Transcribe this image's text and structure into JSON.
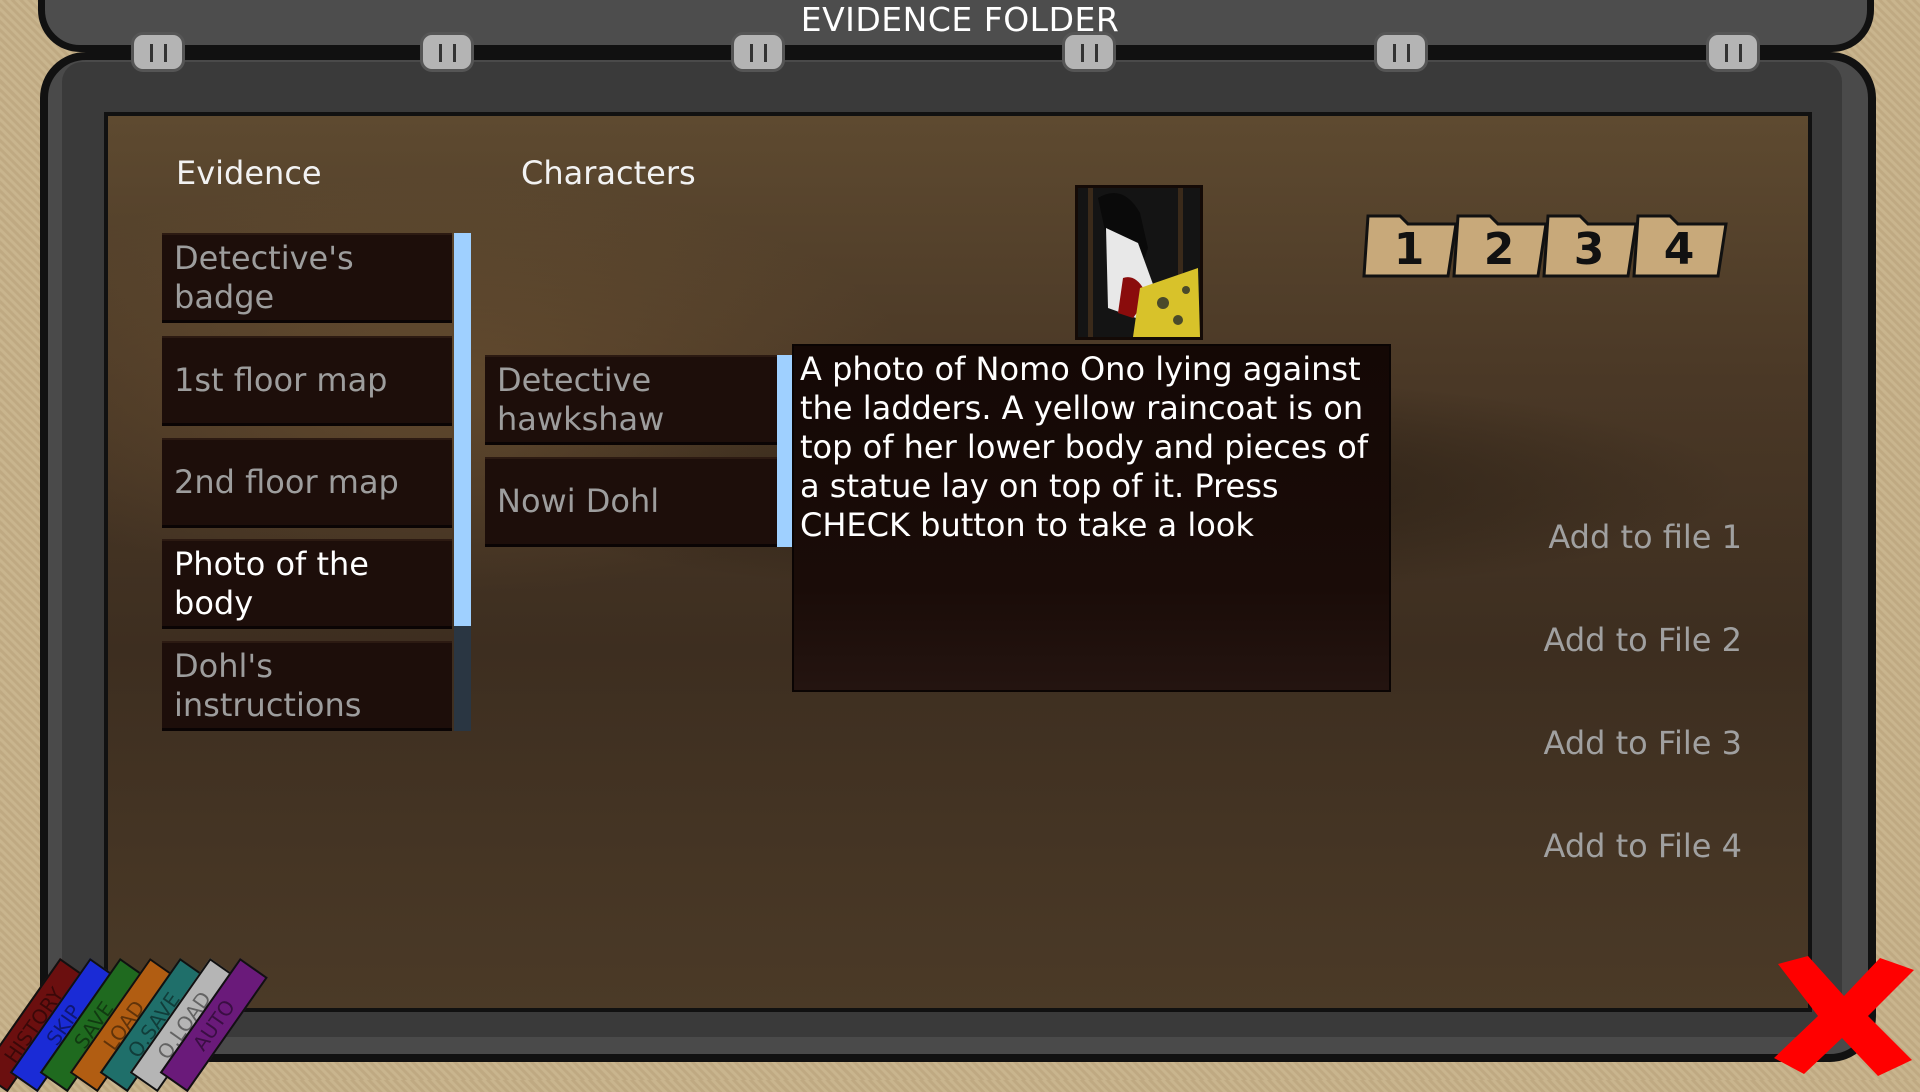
{
  "window": {
    "title": "EVIDENCE FOLDER"
  },
  "columns": {
    "evidence_heading": "Evidence",
    "characters_heading": "Characters"
  },
  "evidence": {
    "items": [
      {
        "label": "Detective's badge",
        "selected": false
      },
      {
        "label": "1st floor map",
        "selected": false
      },
      {
        "label": "2nd floor map",
        "selected": false
      },
      {
        "label": "Photo of the body",
        "selected": true
      },
      {
        "label": "Dohl's instructions",
        "selected": false
      }
    ],
    "scroll_fraction_visible": 0.79
  },
  "characters": {
    "items": [
      {
        "label": "Detective hawkshaw"
      },
      {
        "label": "Nowi Dohl"
      }
    ]
  },
  "description": "A photo of Nomo Ono lying against the ladders. A yellow raincoat is on top of her lower body and pieces of a statue lay on top of it. Press CHECK button to take a look",
  "file_tabs": [
    "1",
    "2",
    "3",
    "4"
  ],
  "add_links": [
    "Add to file 1",
    "Add to File 2",
    "Add to File 3",
    "Add to File 4"
  ],
  "quick_menu": [
    {
      "label": "HISTORY",
      "color": "#6b0f0f"
    },
    {
      "label": "SKIP",
      "color": "#1a2bd6"
    },
    {
      "label": "SAVE",
      "color": "#1f6a1f"
    },
    {
      "label": "LOAD",
      "color": "#b15d12"
    },
    {
      "label": "Q.SAVE",
      "color": "#1f6f6a"
    },
    {
      "label": "Q.LOAD",
      "color": "#b5b5b5"
    },
    {
      "label": "AUTO",
      "color": "#6a1a7a"
    }
  ],
  "colors": {
    "selection_accent": "#9fd0ff",
    "close_icon": "#ff0000",
    "folder_tab": "#c8a97a"
  }
}
